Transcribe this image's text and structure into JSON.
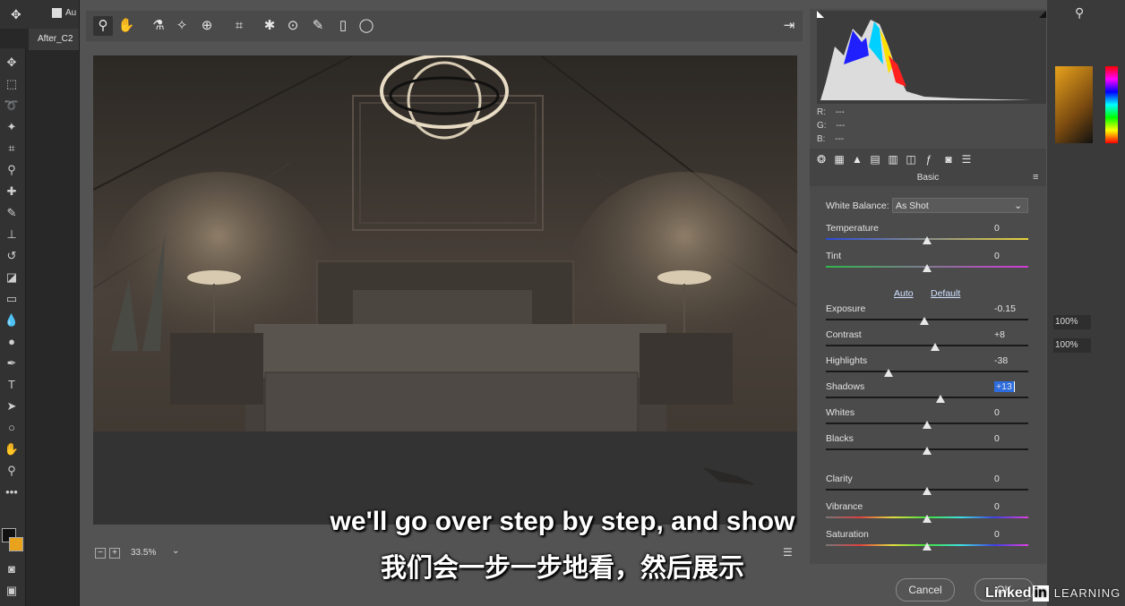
{
  "photoshop": {
    "options_checkbox_label": "Au",
    "document_tab": "After_C2",
    "zoom_value_1": "100%",
    "zoom_value_2": "100%"
  },
  "camera_raw": {
    "zoom_level": "33.5%",
    "readout": {
      "r_label": "R:",
      "r_value": "---",
      "g_label": "G:",
      "g_value": "---",
      "b_label": "B:",
      "b_value": "---"
    },
    "panel_title": "Basic",
    "white_balance": {
      "label": "White Balance:",
      "value": "As Shot"
    },
    "links": {
      "auto": "Auto",
      "default": "Default"
    },
    "sliders": [
      {
        "label": "Temperature",
        "value": "0",
        "position": 0.5
      },
      {
        "label": "Tint",
        "value": "0",
        "position": 0.5
      },
      {
        "label": "Exposure",
        "value": "-0.15",
        "position": 0.485
      },
      {
        "label": "Contrast",
        "value": "+8",
        "position": 0.54
      },
      {
        "label": "Highlights",
        "value": "-38",
        "position": 0.31
      },
      {
        "label": "Shadows",
        "value": "+13",
        "position": 0.565
      },
      {
        "label": "Whites",
        "value": "0",
        "position": 0.5
      },
      {
        "label": "Blacks",
        "value": "0",
        "position": 0.5
      },
      {
        "label": "Clarity",
        "value": "0",
        "position": 0.5
      },
      {
        "label": "Vibrance",
        "value": "0",
        "position": 0.5
      },
      {
        "label": "Saturation",
        "value": "0",
        "position": 0.5
      }
    ],
    "buttons": {
      "cancel": "Cancel",
      "ok": "OK"
    }
  },
  "subtitles": {
    "english": "we'll go over step by step, and show",
    "chinese": "我们会一步一步地看，然后展示"
  },
  "watermark": {
    "brand_a": "Linked",
    "brand_b": "in",
    "brand_c": "LEARNING"
  },
  "colors": {
    "panel": "#535353",
    "accent_select": "#2d6de0"
  }
}
